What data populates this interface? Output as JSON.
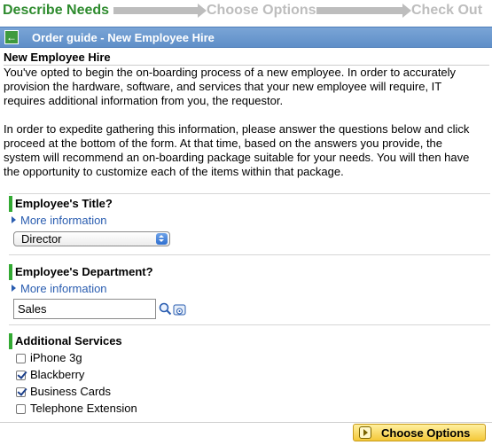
{
  "steps": {
    "step1": "Describe Needs",
    "step2": "Choose Options",
    "step3": "Check Out"
  },
  "titlebar": {
    "title": "Order guide - New Employee Hire",
    "back_icon": "back-arrow-icon"
  },
  "intro": {
    "heading": "New Employee Hire",
    "para1": [
      "You've opted to begin the on-boarding process of a new employee. In order to accurately",
      "provision the hardware, software, and services that your new employee will require, IT",
      "requires additional information from you, the requestor."
    ],
    "para2": [
      "In order to expedite gathering this information, please answer the questions below and click",
      "proceed at the bottom of the form. At that time, based on the answers you provide, the",
      "system will recommend an on-boarding package suitable for your needs. You will then have",
      "the opportunity to customize each of the items within that package."
    ]
  },
  "sections": {
    "title": {
      "label": "Employee's Title?",
      "more": "More information",
      "selected": "Director"
    },
    "department": {
      "label": "Employee's Department?",
      "more": "More information",
      "value": "Sales"
    },
    "services": {
      "label": "Additional Services",
      "items": [
        {
          "label": "iPhone 3g",
          "checked": false
        },
        {
          "label": "Blackberry",
          "checked": true
        },
        {
          "label": "Business Cards",
          "checked": true
        },
        {
          "label": "Telephone Extension",
          "checked": false
        }
      ]
    }
  },
  "footer": {
    "choose_label": "Choose Options"
  }
}
